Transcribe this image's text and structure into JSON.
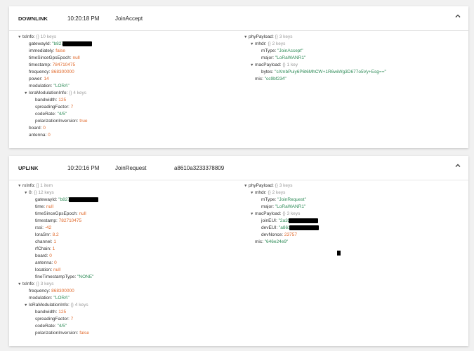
{
  "uplink_card": {
    "type": "UPLINK",
    "time": "10:20:16 PM",
    "message": "JoinRequest",
    "dev_eui": "a8610a3233378809"
  },
  "downlink_card": {
    "type": "DOWNLINK",
    "time": "10:20:18 PM",
    "message": "JoinAccept"
  },
  "downlink_left": [
    {
      "i": 0,
      "arrow": "▼",
      "key": "txInfo:",
      "count": "{} 10 keys"
    },
    {
      "i": 1,
      "key": "gatewayId:",
      "val": "\"b827",
      "vc": "s",
      "redact": true
    },
    {
      "i": 1,
      "key": "immediately:",
      "val": "false",
      "vc": "b"
    },
    {
      "i": 1,
      "key": "timeSinceGpsEpoch:",
      "val": "null",
      "vc": "nl"
    },
    {
      "i": 1,
      "key": "timestamp:",
      "val": "784710475",
      "vc": "n"
    },
    {
      "i": 1,
      "key": "frequency:",
      "val": "868300000",
      "vc": "n"
    },
    {
      "i": 1,
      "key": "power:",
      "val": "14",
      "vc": "n"
    },
    {
      "i": 1,
      "key": "modulation:",
      "val": "\"LORA\"",
      "vc": "s"
    },
    {
      "i": 1,
      "arrow": "▼",
      "key": "loraModulationInfo:",
      "count": "{} 4 keys"
    },
    {
      "i": 2,
      "key": "bandwidth:",
      "val": "125",
      "vc": "n"
    },
    {
      "i": 2,
      "key": "spreadingFactor:",
      "val": "7",
      "vc": "n"
    },
    {
      "i": 2,
      "key": "codeRate:",
      "val": "\"4/5\"",
      "vc": "s"
    },
    {
      "i": 2,
      "key": "polarizationInversion:",
      "val": "true",
      "vc": "b"
    },
    {
      "i": 1,
      "key": "board:",
      "val": "0",
      "vc": "n"
    },
    {
      "i": 1,
      "key": "antenna:",
      "val": "0",
      "vc": "n"
    }
  ],
  "downlink_right": [
    {
      "i": 0,
      "arrow": "▼",
      "key": "phyPayload:",
      "count": "{} 3 keys"
    },
    {
      "i": 1,
      "arrow": "▼",
      "key": "mhdr:",
      "count": "{} 2 keys"
    },
    {
      "i": 2,
      "key": "mType:",
      "val": "\"JoinAccept\"",
      "vc": "s"
    },
    {
      "i": 2,
      "key": "major:",
      "val": "\"LoRaWANR1\"",
      "vc": "s"
    },
    {
      "i": 1,
      "arrow": "▼",
      "key": "macPayload:",
      "count": "{} 1 key"
    },
    {
      "i": 2,
      "key": "bytes:",
      "val": "\"cXmbPuiy6P6t6MhCW+1R6wiWg3D677o5Vy+Esg==\"",
      "vc": "s"
    },
    {
      "i": 1,
      "key": "mic:",
      "val": "\"cc9bf234\"",
      "vc": "s"
    }
  ],
  "uplink_left": [
    {
      "i": 0,
      "arrow": "▼",
      "key": "rxInfo:",
      "count": "[] 1 item"
    },
    {
      "i": 1,
      "arrow": "▼",
      "key": "0:",
      "count": "{} 12 keys"
    },
    {
      "i": 2,
      "key": "gatewayId:",
      "val": "\"b827",
      "vc": "s",
      "redact": true
    },
    {
      "i": 2,
      "key": "time:",
      "val": "null",
      "vc": "nl"
    },
    {
      "i": 2,
      "key": "timeSinceGpsEpoch:",
      "val": "null",
      "vc": "nl"
    },
    {
      "i": 2,
      "key": "timestamp:",
      "val": "782710475",
      "vc": "n"
    },
    {
      "i": 2,
      "key": "rssi:",
      "val": "-42",
      "vc": "n"
    },
    {
      "i": 2,
      "key": "loraSnr:",
      "val": "8.2",
      "vc": "n"
    },
    {
      "i": 2,
      "key": "channel:",
      "val": "1",
      "vc": "n"
    },
    {
      "i": 2,
      "key": "rfChain:",
      "val": "1",
      "vc": "n"
    },
    {
      "i": 2,
      "key": "board:",
      "val": "0",
      "vc": "n"
    },
    {
      "i": 2,
      "key": "antenna:",
      "val": "0",
      "vc": "n"
    },
    {
      "i": 2,
      "key": "location:",
      "val": "null",
      "vc": "nl"
    },
    {
      "i": 2,
      "key": "fineTimestampType:",
      "val": "\"NONE\"",
      "vc": "s"
    },
    {
      "i": 0,
      "arrow": "▼",
      "key": "txInfo:",
      "count": "{} 3 keys"
    },
    {
      "i": 1,
      "key": "frequency:",
      "val": "868300000",
      "vc": "n"
    },
    {
      "i": 1,
      "key": "modulation:",
      "val": "\"LORA\"",
      "vc": "s"
    },
    {
      "i": 1,
      "arrow": "▼",
      "key": "loRaModulationInfo:",
      "count": "{} 4 keys"
    },
    {
      "i": 2,
      "key": "bandwidth:",
      "val": "125",
      "vc": "n"
    },
    {
      "i": 2,
      "key": "spreadingFactor:",
      "val": "7",
      "vc": "n"
    },
    {
      "i": 2,
      "key": "codeRate:",
      "val": "\"4/5\"",
      "vc": "s"
    },
    {
      "i": 2,
      "key": "polarizationInversion:",
      "val": "false",
      "vc": "b"
    }
  ],
  "uplink_right": [
    {
      "i": 0,
      "arrow": "▼",
      "key": "phyPayload:",
      "count": "{} 3 keys"
    },
    {
      "i": 1,
      "arrow": "▼",
      "key": "mhdr:",
      "count": "{} 2 keys"
    },
    {
      "i": 2,
      "key": "mType:",
      "val": "\"JoinRequest\"",
      "vc": "s"
    },
    {
      "i": 2,
      "key": "major:",
      "val": "\"LoRaWANR1\"",
      "vc": "s"
    },
    {
      "i": 1,
      "arrow": "▼",
      "key": "macPayload:",
      "count": "{} 3 keys"
    },
    {
      "i": 2,
      "key": "joinEUI:",
      "val": "\"2a32",
      "vc": "s",
      "redact": true
    },
    {
      "i": 2,
      "key": "devEUI:",
      "val": "\"a861",
      "vc": "s",
      "redact": true
    },
    {
      "i": 2,
      "key": "devNonce:",
      "val": "23757",
      "vc": "n"
    },
    {
      "i": 1,
      "key": "mic:",
      "val": "\"646e24e9\"",
      "vc": "s"
    }
  ],
  "icons": {
    "collapse": "chevron-up-icon",
    "expand": "triangle-down-icon"
  }
}
